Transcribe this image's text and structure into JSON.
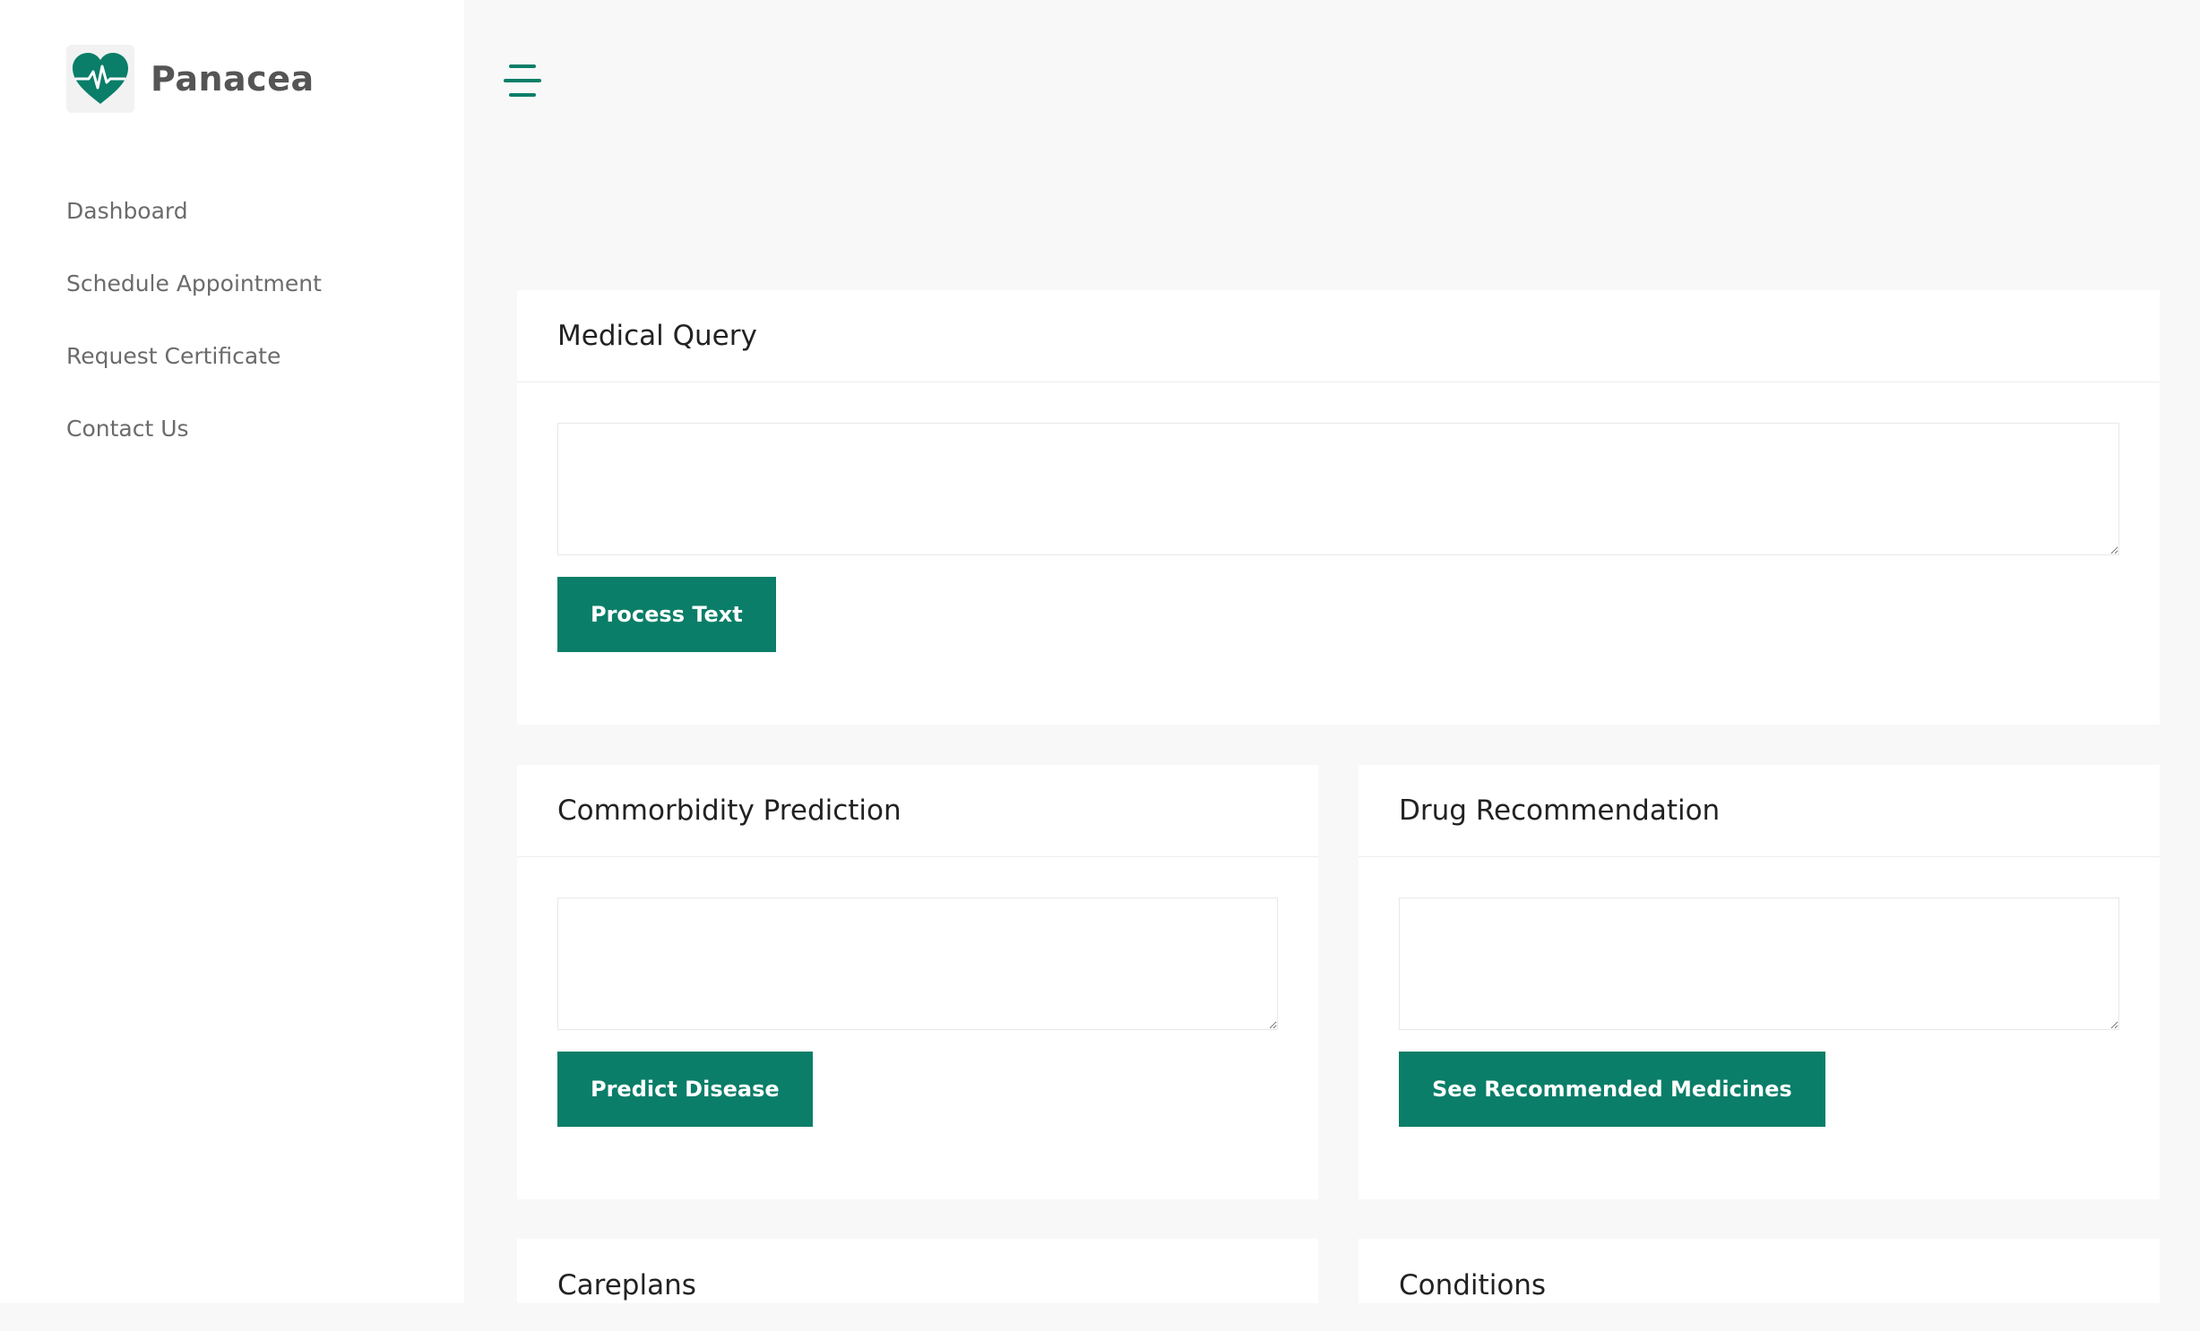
{
  "brand": {
    "name": "Panacea",
    "logo_icon": "heart-pulse-icon",
    "accent_color": "#0a7e68"
  },
  "sidebar": {
    "items": [
      {
        "label": "Dashboard"
      },
      {
        "label": "Schedule Appointment"
      },
      {
        "label": "Request Certificate"
      },
      {
        "label": "Contact Us"
      }
    ]
  },
  "header": {
    "menu_icon": "hamburger-menu-icon"
  },
  "cards": {
    "medical_query": {
      "title": "Medical Query",
      "value": "",
      "button_label": "Process Text"
    },
    "commorbidity": {
      "title": "Commorbidity Prediction",
      "value": "",
      "button_label": "Predict Disease"
    },
    "drug_recommendation": {
      "title": "Drug Recommendation",
      "value": "",
      "button_label": "See Recommended Medicines"
    },
    "careplans": {
      "title": "Careplans"
    },
    "conditions": {
      "title": "Conditions"
    }
  }
}
